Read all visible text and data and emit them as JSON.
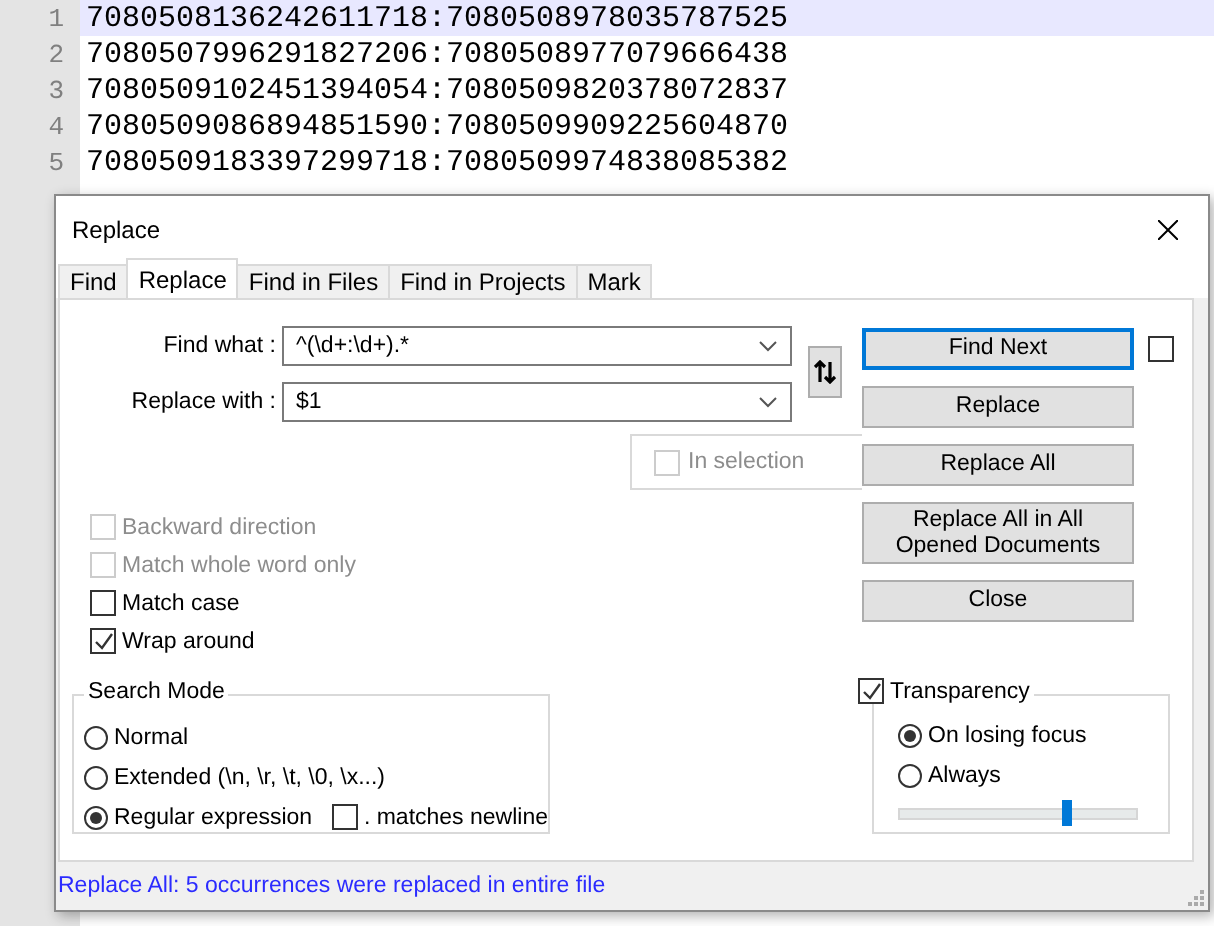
{
  "editor": {
    "lines": [
      {
        "number": "1",
        "text": "7080508136242611718:7080508978035787525",
        "current": true
      },
      {
        "number": "2",
        "text": "7080507996291827206:7080508977079666438",
        "current": false
      },
      {
        "number": "3",
        "text": "7080509102451394054:7080509820378072837",
        "current": false
      },
      {
        "number": "4",
        "text": "7080509086894851590:7080509909225604870",
        "current": false
      },
      {
        "number": "5",
        "text": "7080509183397299718:7080509974838085382",
        "current": false
      }
    ]
  },
  "dialog": {
    "title": "Replace",
    "tabs": [
      {
        "label": "Find",
        "selected": false
      },
      {
        "label": "Replace",
        "selected": true
      },
      {
        "label": "Find in Files",
        "selected": false
      },
      {
        "label": "Find in Projects",
        "selected": false
      },
      {
        "label": "Mark",
        "selected": false
      }
    ],
    "find_what": {
      "label": "Find what :",
      "value": "^(\\d+:\\d+).*"
    },
    "replace_with": {
      "label": "Replace with :",
      "value": "$1"
    },
    "in_selection": {
      "label": "In selection",
      "checked": false,
      "disabled": true
    },
    "options": [
      {
        "label": "Backward direction",
        "checked": false,
        "disabled": true
      },
      {
        "label": "Match whole word only",
        "checked": false,
        "disabled": true
      },
      {
        "label": "Match case",
        "checked": false,
        "disabled": false
      },
      {
        "label": "Wrap around",
        "checked": true,
        "disabled": false
      }
    ],
    "buttons": [
      {
        "label": "Find Next",
        "focused": true
      },
      {
        "label": "Replace",
        "focused": false
      },
      {
        "label": "Replace All",
        "focused": false
      },
      {
        "label": "Replace All in All Opened Documents",
        "focused": false
      },
      {
        "label": "Close",
        "focused": false
      }
    ],
    "side_checkbox": {
      "checked": false
    },
    "search_mode": {
      "title": "Search Mode",
      "options": [
        {
          "label": "Normal",
          "selected": false
        },
        {
          "label": "Extended (\\n, \\r, \\t, \\0, \\x...)",
          "selected": false
        },
        {
          "label": "Regular expression",
          "selected": true
        }
      ],
      "dot_matches_newline": {
        "label": ". matches newline",
        "checked": false
      }
    },
    "transparency": {
      "label": "Transparency",
      "checked": true,
      "options": [
        {
          "label": "On losing focus",
          "selected": true
        },
        {
          "label": "Always",
          "selected": false
        }
      ],
      "level": 0.7
    },
    "status": "Replace All: 5 occurrences were replaced in entire file"
  }
}
